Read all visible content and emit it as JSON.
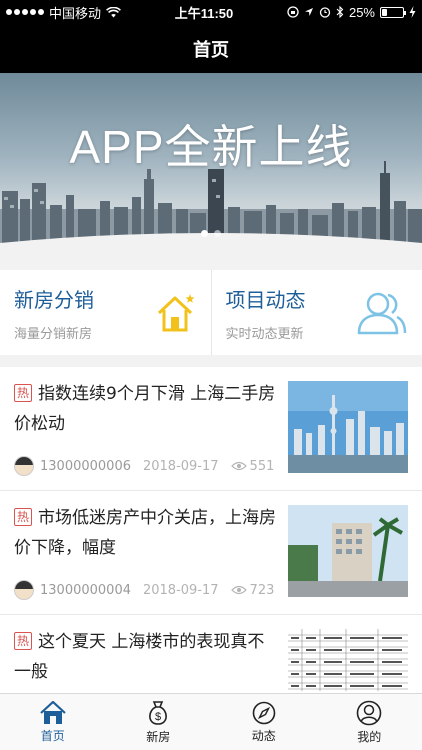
{
  "status_bar": {
    "carrier": "中国移动",
    "time": "上午11:50",
    "battery": "25%",
    "battery_level": 0.25
  },
  "nav": {
    "title": "首页"
  },
  "banner": {
    "title": "APP全新上线",
    "slide_count": 2,
    "active_slide": 1
  },
  "entries": [
    {
      "title": "新房分销",
      "subtitle": "海量分销新房",
      "icon": "house-star-icon"
    },
    {
      "title": "项目动态",
      "subtitle": "实时动态更新",
      "icon": "users-icon"
    }
  ],
  "news": [
    {
      "tag": "热",
      "title": "指数连续9个月下滑 上海二手房价松动",
      "author": "13000000006",
      "date": "2018-09-17",
      "views": "551",
      "thumb": "city-skyline"
    },
    {
      "tag": "热",
      "title": "市场低迷房产中介关店，上海房价下降，幅度",
      "author": "13000000004",
      "date": "2018-09-17",
      "views": "723",
      "thumb": "residential-street"
    },
    {
      "tag": "热",
      "title": "这个夏天 上海楼市的表现真不一般",
      "author": "",
      "date": "",
      "views": "",
      "thumb": "data-table"
    }
  ],
  "tabs": [
    {
      "label": "首页",
      "icon": "home-icon",
      "active": true
    },
    {
      "label": "新房",
      "icon": "money-bag-icon",
      "active": false
    },
    {
      "label": "动态",
      "icon": "compass-icon",
      "active": false
    },
    {
      "label": "我的",
      "icon": "user-icon",
      "active": false
    }
  ],
  "colors": {
    "accent": "#1e5e99",
    "hot": "#d9534f",
    "icon_yellow": "#f2c21b",
    "icon_blue": "#7ec3e6"
  }
}
